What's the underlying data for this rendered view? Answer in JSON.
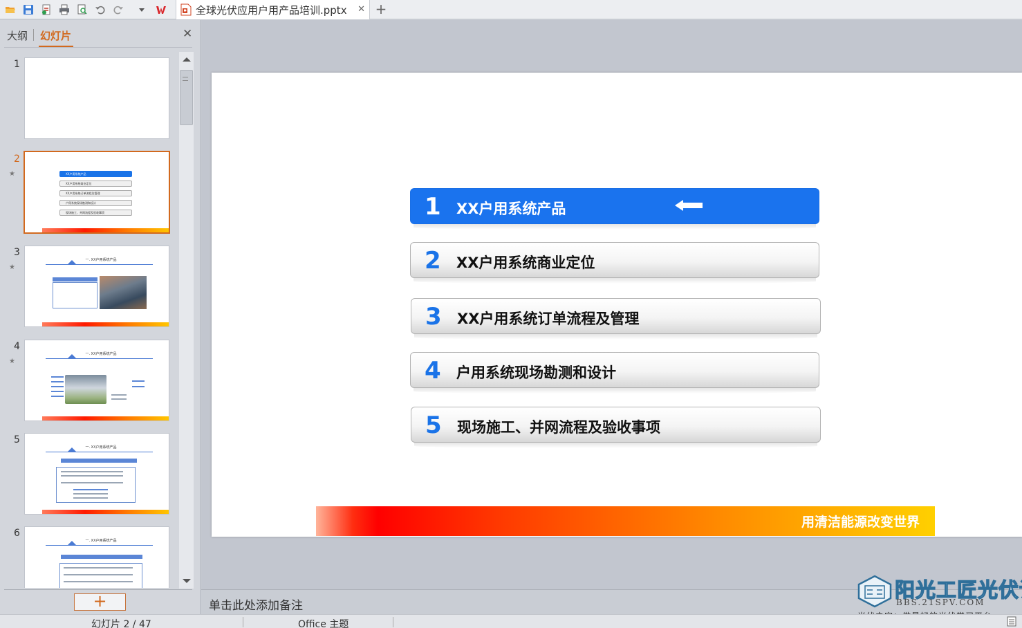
{
  "window": {
    "document_tab_title": "全球光伏应用户用产品培训.pptx",
    "quick_access_icons": [
      "open-folder-icon",
      "save-icon",
      "export-pdf-icon",
      "print-icon",
      "print-preview-icon",
      "undo-icon",
      "redo-icon",
      "customize-dropdown-icon",
      "wps-logo-icon"
    ],
    "new_tab_label": "+"
  },
  "left_panel": {
    "tab_outline": "大纲",
    "tab_slides": "幻灯片",
    "close_label": "✕",
    "add_slide_label": "+",
    "thumbnails": [
      {
        "number": "1"
      },
      {
        "number": "2",
        "items": [
          "XX户用系统产品",
          "XX户用系统商业定位",
          "XX户用系统订单流程及管理",
          "户用系统现场勘测和设计",
          "现场施工、并网流程及验收事项"
        ]
      },
      {
        "number": "3",
        "title": "一. XX户用系统产品"
      },
      {
        "number": "4",
        "title": "一. XX户用系统产品"
      },
      {
        "number": "5",
        "title": "一. XX户用系统产品"
      },
      {
        "number": "6",
        "title": "一. XX户用系统产品"
      }
    ]
  },
  "slide": {
    "items": [
      {
        "num": "1",
        "label": "XX户用系统产品",
        "active": true
      },
      {
        "num": "2",
        "label": "XX户用系统商业定位",
        "active": false
      },
      {
        "num": "3",
        "label": "XX户用系统订单流程及管理",
        "active": false
      },
      {
        "num": "4",
        "label": "户用系统现场勘测和设计",
        "active": false
      },
      {
        "num": "5",
        "label": "现场施工、并网流程及验收事项",
        "active": false
      }
    ],
    "slogan": "用清洁能源改变世界",
    "colors": {
      "accent_blue": "#1a73ee",
      "bar_start": "#ff0000",
      "bar_end": "#ffd000"
    }
  },
  "notes": {
    "placeholder": "单击此处添加备注"
  },
  "watermark": {
    "title": "阳光工匠光伏论坛",
    "url": "BBS.21SPV.COM",
    "subtitle": "光伏之家：做最好的光伏学习平台"
  },
  "status": {
    "slide_indicator": "幻灯片 2 / 47",
    "theme": "Office 主题"
  }
}
